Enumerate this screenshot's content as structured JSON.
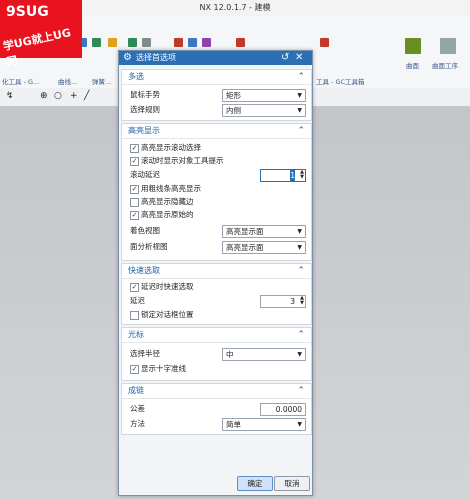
{
  "window": {
    "title": "NX 12.0.1.7 - 建模"
  },
  "watermark": {
    "line1": "9SUG",
    "line2": "学UG就上UG网"
  },
  "ribbon": {
    "group_labels": [
      "化工具 - G...",
      "曲线...",
      "弹簧...",
      "工具 - GC工具箱",
      "曲面",
      "曲面工序"
    ],
    "icon_colors": [
      "#2e8b57",
      "#3b78c2",
      "#c0392b",
      "#e0a21e",
      "#6b8e23",
      "#8e44ad"
    ]
  },
  "dialog": {
    "title": "选择首选项",
    "sections": {
      "multi": {
        "header": "多选",
        "gesture_label": "鼠标手势",
        "gesture_value": "矩形",
        "rule_label": "选择规则",
        "rule_value": "内侧"
      },
      "highlight": {
        "header": "高亮显示",
        "scroll_select": "高亮显示滚动选择",
        "tooltip": "滚动时显示对象工具提示",
        "delay_label": "滚动延迟",
        "delay_value": "1",
        "thick_line": "用粗线条高亮显示",
        "hidden_edges": "高亮显示隐藏边",
        "original": "高亮显示原始的",
        "shaded_label": "着色视图",
        "shaded_value": "高亮显示面",
        "analysis_label": "面分析视图",
        "analysis_value": "高亮显示面"
      },
      "quick": {
        "header": "快速选取",
        "delayed": "延迟时快速选取",
        "delay_label": "延迟",
        "delay_value": "3",
        "lock": "锁定对话框位置"
      },
      "cursor": {
        "header": "光标",
        "radius_label": "选择半径",
        "radius_value": "中",
        "crosshair": "显示十字准线"
      },
      "chain": {
        "header": "成链",
        "tol_label": "公差",
        "tol_value": "0.0000",
        "method_label": "方法",
        "method_value": "简单"
      }
    },
    "buttons": {
      "ok": "确定",
      "cancel": "取消"
    }
  }
}
